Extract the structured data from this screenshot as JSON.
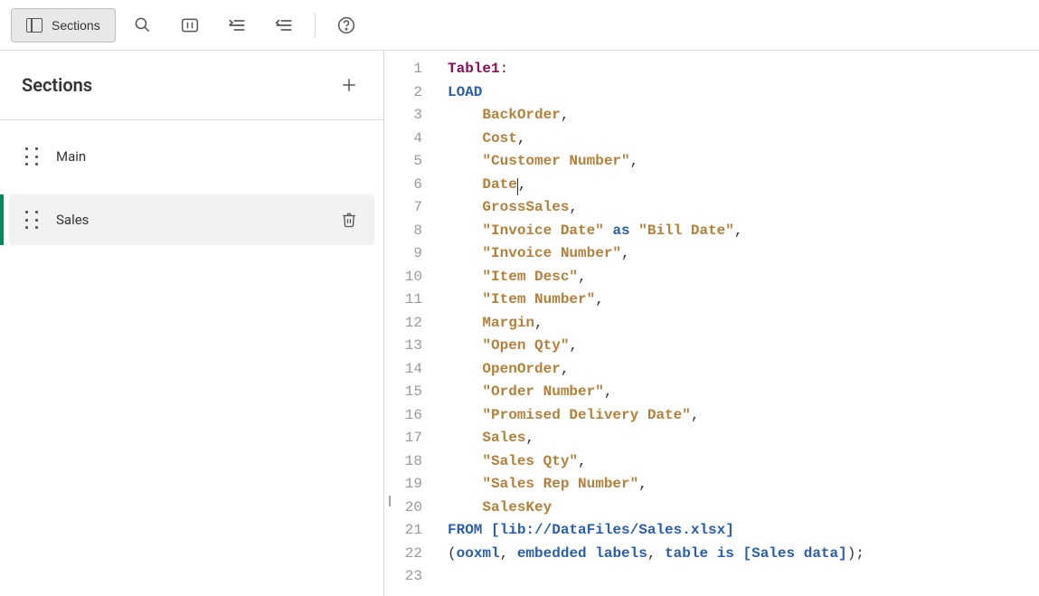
{
  "toolbar": {
    "sections_label": "Sections"
  },
  "sidebar": {
    "title": "Sections",
    "items": [
      {
        "label": "Main",
        "active": false,
        "deletable": false
      },
      {
        "label": "Sales",
        "active": true,
        "deletable": true
      }
    ]
  },
  "editor": {
    "lines": [
      [
        {
          "t": "label",
          "v": "Table1"
        },
        {
          "t": "punc",
          "v": ":"
        }
      ],
      [
        {
          "t": "kw",
          "v": "LOAD"
        }
      ],
      [
        {
          "t": "indent",
          "v": "    "
        },
        {
          "t": "field",
          "v": "BackOrder"
        },
        {
          "t": "punc",
          "v": ","
        }
      ],
      [
        {
          "t": "indent",
          "v": "    "
        },
        {
          "t": "field",
          "v": "Cost"
        },
        {
          "t": "punc",
          "v": ","
        }
      ],
      [
        {
          "t": "indent",
          "v": "    "
        },
        {
          "t": "field",
          "v": "\"Customer Number\""
        },
        {
          "t": "punc",
          "v": ","
        }
      ],
      [
        {
          "t": "indent",
          "v": "    "
        },
        {
          "t": "field",
          "v": "Date"
        },
        {
          "t": "caret",
          "v": ""
        },
        {
          "t": "punc",
          "v": ","
        }
      ],
      [
        {
          "t": "indent",
          "v": "    "
        },
        {
          "t": "field",
          "v": "GrossSales"
        },
        {
          "t": "punc",
          "v": ","
        }
      ],
      [
        {
          "t": "indent",
          "v": "    "
        },
        {
          "t": "field",
          "v": "\"Invoice Date\""
        },
        {
          "t": "punc",
          "v": " "
        },
        {
          "t": "kw",
          "v": "as"
        },
        {
          "t": "punc",
          "v": " "
        },
        {
          "t": "field",
          "v": "\"Bill Date\""
        },
        {
          "t": "punc",
          "v": ","
        }
      ],
      [
        {
          "t": "indent",
          "v": "    "
        },
        {
          "t": "field",
          "v": "\"Invoice Number\""
        },
        {
          "t": "punc",
          "v": ","
        }
      ],
      [
        {
          "t": "indent",
          "v": "    "
        },
        {
          "t": "field",
          "v": "\"Item Desc\""
        },
        {
          "t": "punc",
          "v": ","
        }
      ],
      [
        {
          "t": "indent",
          "v": "    "
        },
        {
          "t": "field",
          "v": "\"Item Number\""
        },
        {
          "t": "punc",
          "v": ","
        }
      ],
      [
        {
          "t": "indent",
          "v": "    "
        },
        {
          "t": "field",
          "v": "Margin"
        },
        {
          "t": "punc",
          "v": ","
        }
      ],
      [
        {
          "t": "indent",
          "v": "    "
        },
        {
          "t": "field",
          "v": "\"Open Qty\""
        },
        {
          "t": "punc",
          "v": ","
        }
      ],
      [
        {
          "t": "indent",
          "v": "    "
        },
        {
          "t": "field",
          "v": "OpenOrder"
        },
        {
          "t": "punc",
          "v": ","
        }
      ],
      [
        {
          "t": "indent",
          "v": "    "
        },
        {
          "t": "field",
          "v": "\"Order Number\""
        },
        {
          "t": "punc",
          "v": ","
        }
      ],
      [
        {
          "t": "indent",
          "v": "    "
        },
        {
          "t": "field",
          "v": "\"Promised Delivery Date\""
        },
        {
          "t": "punc",
          "v": ","
        }
      ],
      [
        {
          "t": "indent",
          "v": "    "
        },
        {
          "t": "field",
          "v": "Sales"
        },
        {
          "t": "punc",
          "v": ","
        }
      ],
      [
        {
          "t": "indent",
          "v": "    "
        },
        {
          "t": "field",
          "v": "\"Sales Qty\""
        },
        {
          "t": "punc",
          "v": ","
        }
      ],
      [
        {
          "t": "indent",
          "v": "    "
        },
        {
          "t": "field",
          "v": "\"Sales Rep Number\""
        },
        {
          "t": "punc",
          "v": ","
        }
      ],
      [
        {
          "t": "indent",
          "v": "    "
        },
        {
          "t": "field",
          "v": "SalesKey"
        }
      ],
      [
        {
          "t": "kw",
          "v": "FROM"
        },
        {
          "t": "punc",
          "v": " "
        },
        {
          "t": "lib",
          "v": "[lib://DataFiles/Sales.xlsx]"
        }
      ],
      [
        {
          "t": "punc",
          "v": "("
        },
        {
          "t": "kw",
          "v": "ooxml"
        },
        {
          "t": "punc",
          "v": ", "
        },
        {
          "t": "kw",
          "v": "embedded"
        },
        {
          "t": "punc",
          "v": " "
        },
        {
          "t": "kw",
          "v": "labels"
        },
        {
          "t": "punc",
          "v": ", "
        },
        {
          "t": "kw",
          "v": "table"
        },
        {
          "t": "punc",
          "v": " "
        },
        {
          "t": "kw",
          "v": "is"
        },
        {
          "t": "punc",
          "v": " "
        },
        {
          "t": "lib",
          "v": "[Sales data]"
        },
        {
          "t": "punc",
          "v": ");"
        }
      ],
      []
    ]
  }
}
